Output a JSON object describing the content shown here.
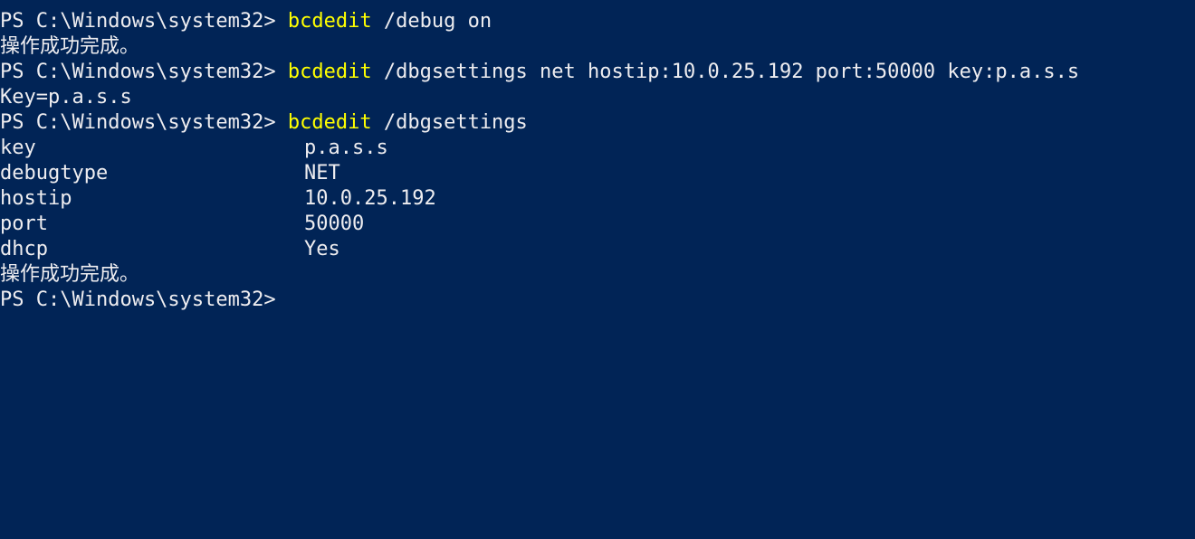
{
  "terminal": {
    "prompt": "PS C:\\Windows\\system32> ",
    "commands": [
      {
        "name": "bcdedit",
        "args": " /debug on"
      },
      {
        "name": "bcdedit",
        "args": " /dbgsettings net hostip:10.0.25.192 port:50000 key:p.a.s.s"
      },
      {
        "name": "bcdedit",
        "args": " /dbgsettings"
      }
    ],
    "success_message": "操作成功完成。",
    "key_output": "Key=p.a.s.s",
    "settings": [
      {
        "key": "key",
        "value": "p.a.s.s"
      },
      {
        "key": "debugtype",
        "value": "NET"
      },
      {
        "key": "hostip",
        "value": "10.0.25.192"
      },
      {
        "key": "port",
        "value": "50000"
      },
      {
        "key": "dhcp",
        "value": "Yes"
      }
    ]
  },
  "colors": {
    "background": "#012456",
    "text": "#eeedf0",
    "command": "#ffff00"
  }
}
